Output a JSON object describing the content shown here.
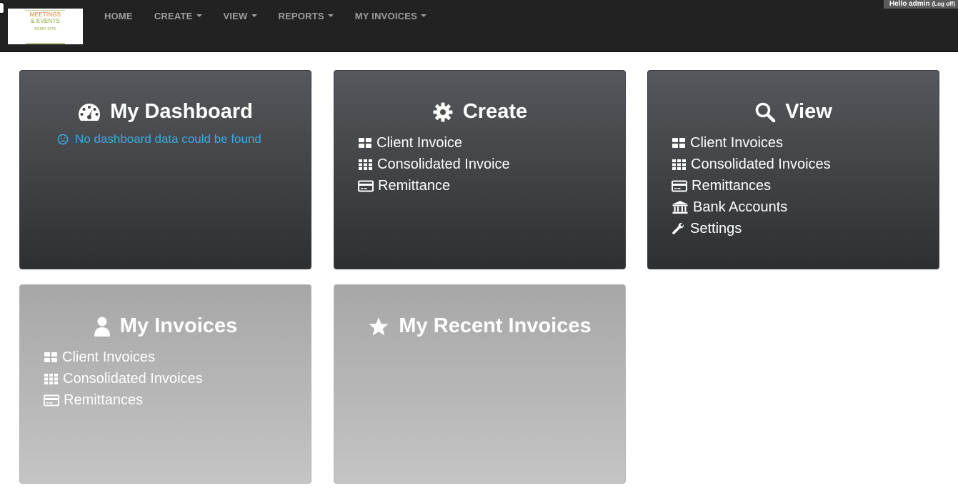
{
  "logo": {
    "line1": "MEETINGS",
    "line2": "& EVENTS",
    "subtitle": "DEMO SITE"
  },
  "nav": {
    "home": "HOME",
    "create": "CREATE",
    "view": "VIEW",
    "reports": "REPORTS",
    "my_invoices": "MY INVOICES"
  },
  "user": {
    "greeting": "Hello admin",
    "logoff": "(Log off)"
  },
  "tiles": {
    "dashboard": {
      "title": "My Dashboard",
      "icon": "dashboard-icon",
      "message": "No dashboard data could be found"
    },
    "create": {
      "title": "Create",
      "icon": "gear-icon",
      "links": [
        "Client Invoice",
        "Consolidated Invoice",
        "Remittance"
      ]
    },
    "view": {
      "title": "View",
      "icon": "search-icon",
      "links": [
        "Client Invoices",
        "Consolidated Invoices",
        "Remittances",
        "Bank Accounts",
        "Settings"
      ]
    },
    "my_invoices": {
      "title": "My Invoices",
      "icon": "user-icon",
      "links": [
        "Client Invoices",
        "Consolidated Invoices",
        "Remittances"
      ]
    },
    "recent": {
      "title": "My Recent Invoices",
      "icon": "star-icon"
    }
  },
  "colors": {
    "navbar": "#222222",
    "tile_dark": "#3f4144",
    "tile_light": "#b5b5b5",
    "accent": "#3aaae0"
  }
}
